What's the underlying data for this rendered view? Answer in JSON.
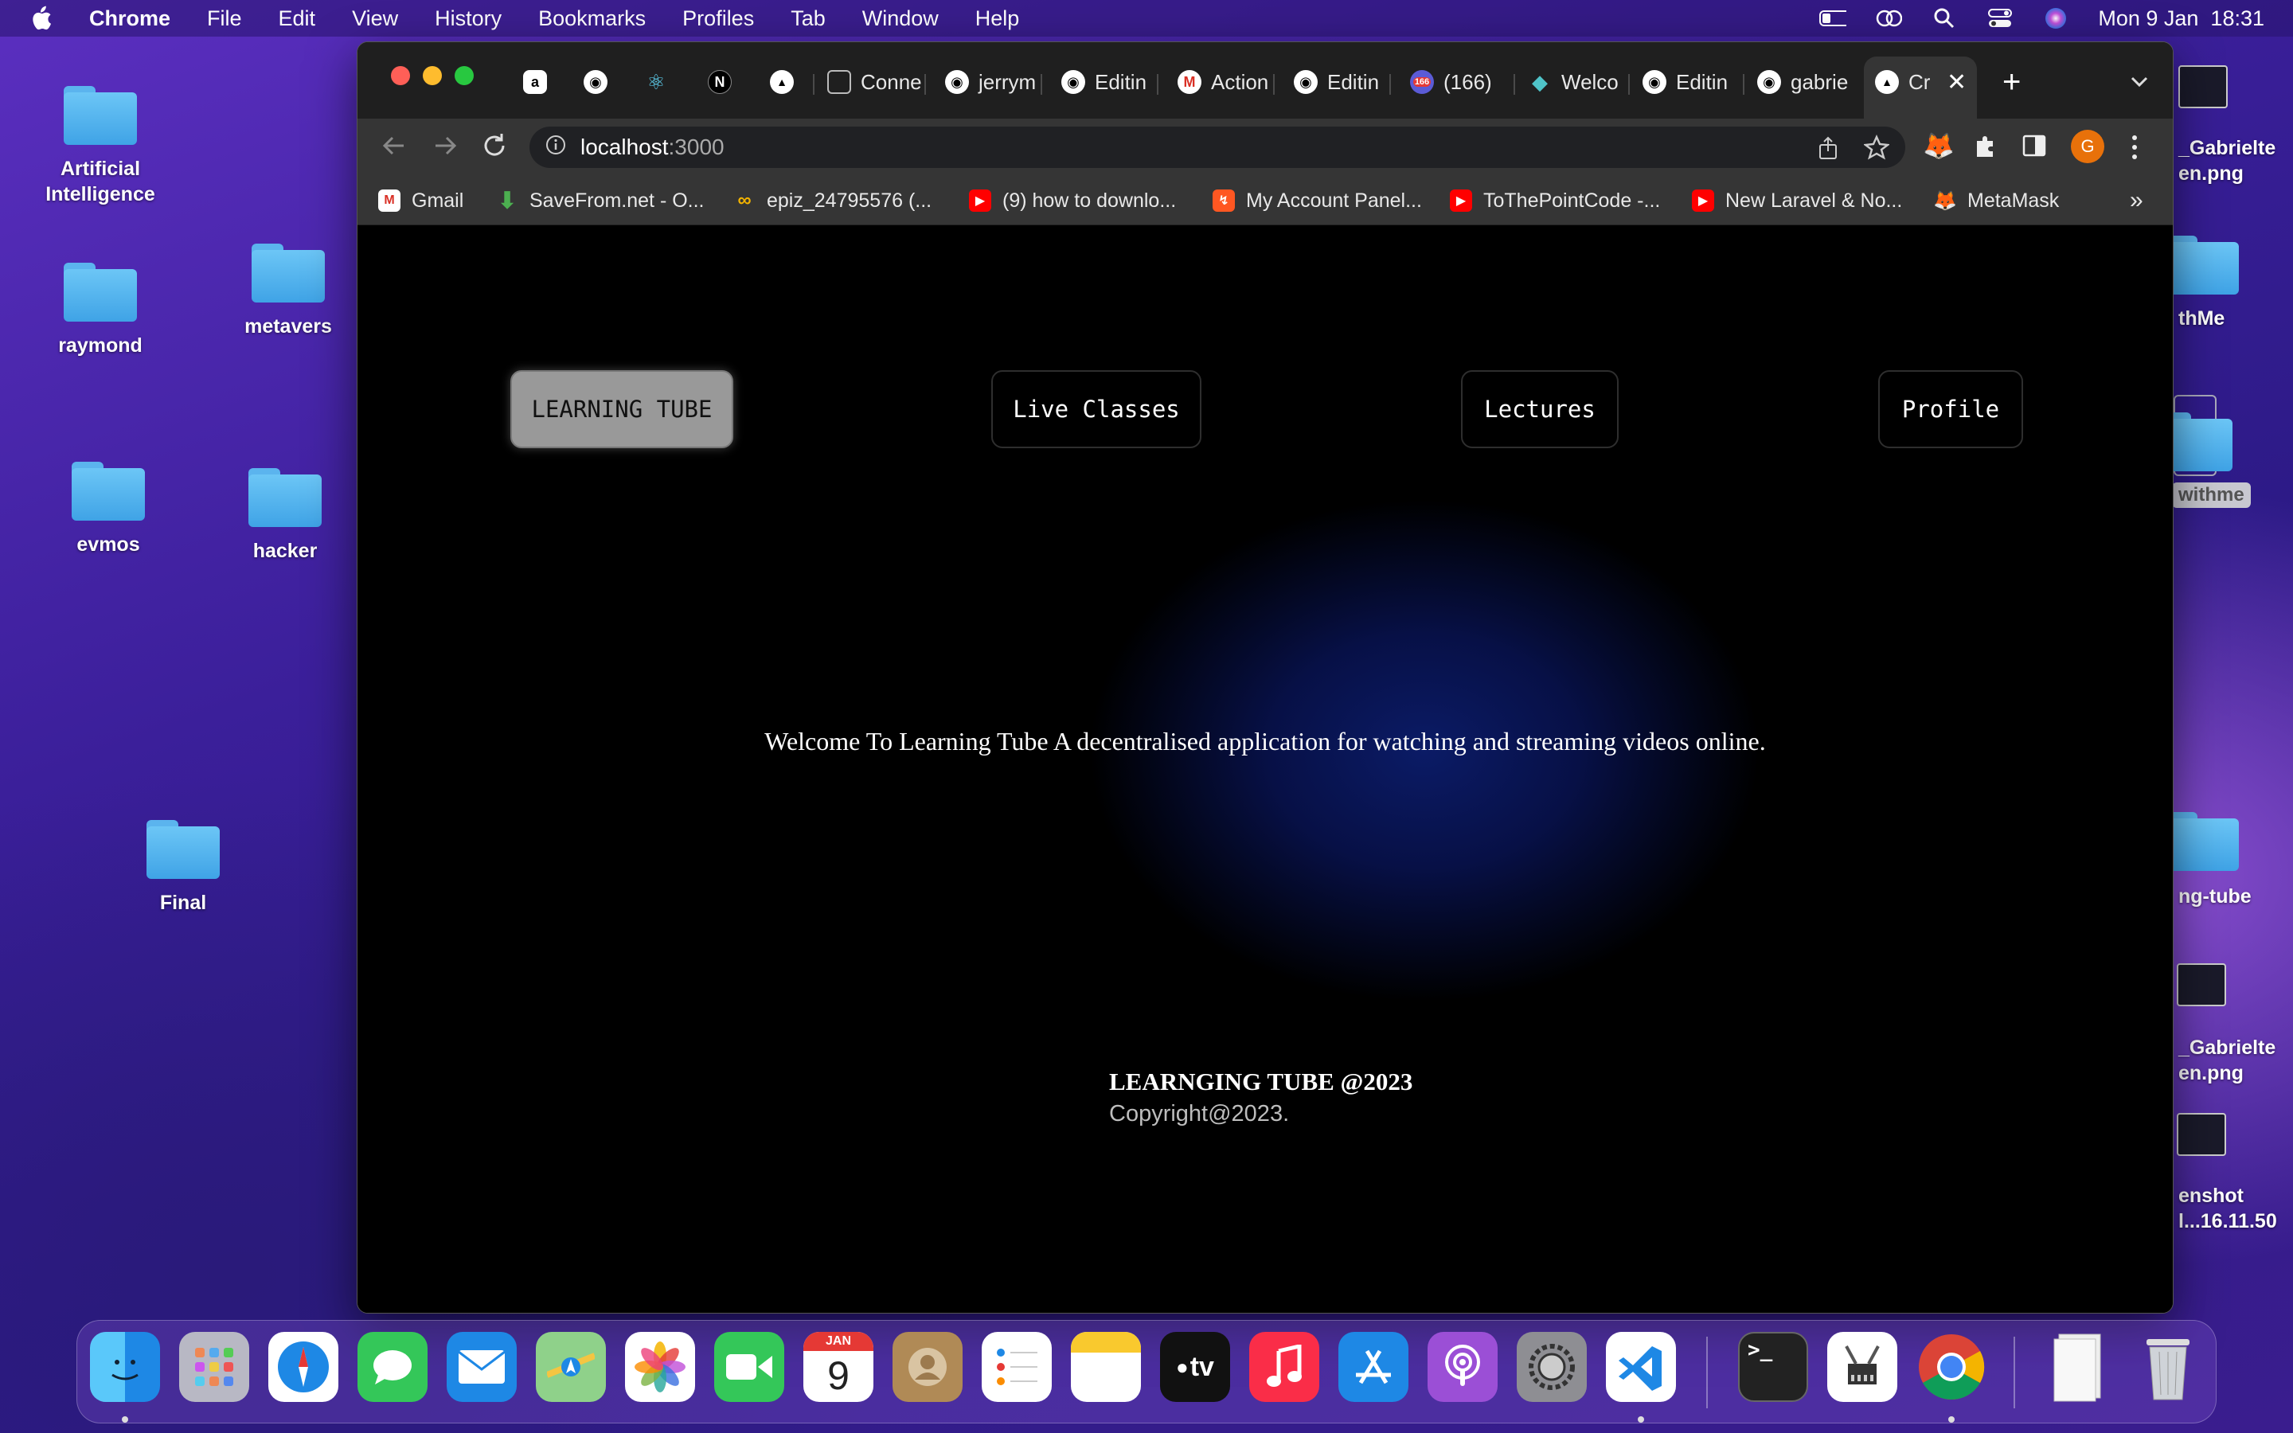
{
  "menubar": {
    "app": "Chrome",
    "items": [
      "File",
      "Edit",
      "View",
      "History",
      "Bookmarks",
      "Profiles",
      "Tab",
      "Window",
      "Help"
    ],
    "datetime": "Mon 9 Jan  18:31"
  },
  "desktop": {
    "left": [
      {
        "label1": "Artificial",
        "label2": "Intelligence"
      },
      {
        "label1": "raymond",
        "label2": ""
      },
      {
        "label1": "metavers",
        "label2": ""
      },
      {
        "label1": "evmos",
        "label2": ""
      },
      {
        "label1": "hacker",
        "label2": ""
      },
      {
        "label1": "Final",
        "label2": ""
      }
    ],
    "right": [
      "_Gabrielte",
      "en.png",
      "thMe",
      "withme",
      "ng-tube",
      "_Gabrielte",
      "en.png",
      "enshot",
      "l...16.11.50"
    ]
  },
  "browser": {
    "tabs": [
      "Conne",
      "jerrym",
      "Editin",
      "Action",
      "Editin",
      "(166)",
      "Welco",
      "Editin",
      "gabrie",
      "Cr"
    ],
    "badge": "166",
    "url_host": "localhost",
    "url_port": ":3000",
    "profile_initial": "G",
    "bookmarks": [
      "Gmail",
      "SaveFrom.net - O...",
      "epiz_24795576 (...",
      "(9) how to downlo...",
      "My Account Panel...",
      "ToThePointCode -...",
      "New Laravel & No...",
      "MetaMask"
    ],
    "more": "»"
  },
  "page": {
    "nav": [
      "LEARNING TUBE",
      "Live Classes",
      "Lectures",
      "Profile"
    ],
    "welcome": "Welcome To Learning Tube A decentralised application for watching and streaming videos online.",
    "footer_title": "LEARNGING TUBE @2023",
    "footer_copy": "Copyright@2023."
  },
  "dock": {
    "calendar_month": "JAN",
    "calendar_day": "9",
    "tv_label": "tv"
  },
  "colors": {
    "accent_active_nav": "#999999",
    "page_glow": "#0b1b66",
    "desktop": "#3b1f9a"
  }
}
